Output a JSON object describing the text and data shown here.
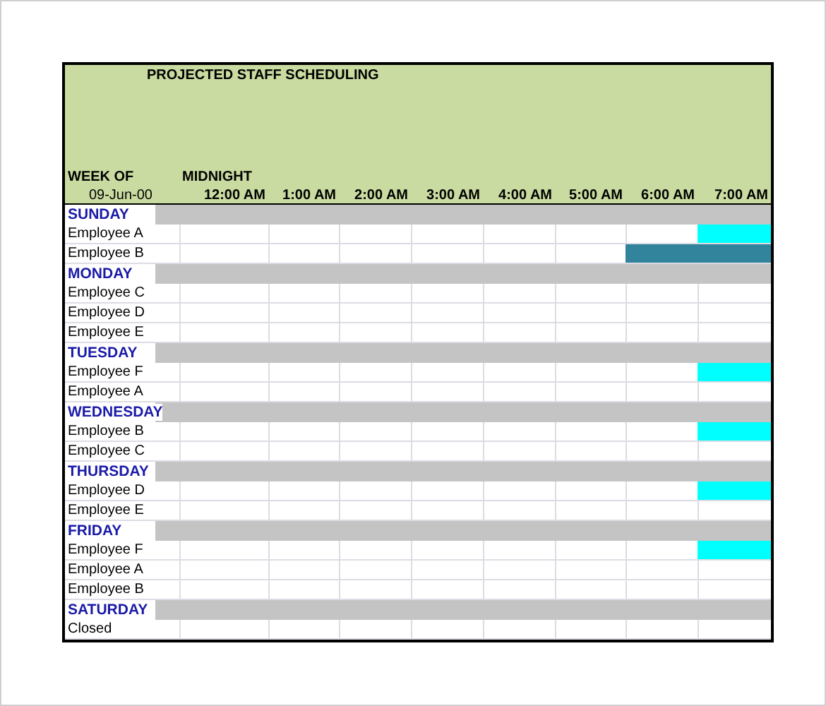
{
  "title": "PROJECTED STAFF SCHEDULING",
  "week_of_label": "WEEK OF",
  "week_of_date": "09-Jun-00",
  "midnight_label": "MIDNIGHT",
  "hours": [
    "12:00 AM",
    "1:00 AM",
    "2:00 AM",
    "3:00 AM",
    "4:00 AM",
    "5:00 AM",
    "6:00 AM",
    "7:00 AM"
  ],
  "rows": [
    {
      "kind": "day",
      "label": "SUNDAY"
    },
    {
      "kind": "employee",
      "label": "Employee A",
      "slots": [
        {
          "on": false
        },
        {
          "on": false
        },
        {
          "on": false
        },
        {
          "on": false
        },
        {
          "on": false
        },
        {
          "on": false
        },
        {
          "on": false
        },
        {
          "on": true,
          "color": "#00ffff"
        }
      ]
    },
    {
      "kind": "employee",
      "label": "Employee B",
      "slots": [
        {
          "on": false
        },
        {
          "on": false
        },
        {
          "on": false
        },
        {
          "on": false
        },
        {
          "on": false
        },
        {
          "on": false
        },
        {
          "on": true,
          "color": "#31849b"
        },
        {
          "on": true,
          "color": "#31849b"
        }
      ]
    },
    {
      "kind": "day",
      "label": "MONDAY"
    },
    {
      "kind": "employee",
      "label": "Employee C",
      "slots": [
        {
          "on": false
        },
        {
          "on": false
        },
        {
          "on": false
        },
        {
          "on": false
        },
        {
          "on": false
        },
        {
          "on": false
        },
        {
          "on": false
        },
        {
          "on": false
        }
      ]
    },
    {
      "kind": "employee",
      "label": "Employee D",
      "slots": [
        {
          "on": false
        },
        {
          "on": false
        },
        {
          "on": false
        },
        {
          "on": false
        },
        {
          "on": false
        },
        {
          "on": false
        },
        {
          "on": false
        },
        {
          "on": false
        }
      ]
    },
    {
      "kind": "employee",
      "label": "Employee E",
      "slots": [
        {
          "on": false
        },
        {
          "on": false
        },
        {
          "on": false
        },
        {
          "on": false
        },
        {
          "on": false
        },
        {
          "on": false
        },
        {
          "on": false
        },
        {
          "on": false
        }
      ]
    },
    {
      "kind": "day",
      "label": "TUESDAY"
    },
    {
      "kind": "employee",
      "label": "Employee F",
      "slots": [
        {
          "on": false
        },
        {
          "on": false
        },
        {
          "on": false
        },
        {
          "on": false
        },
        {
          "on": false
        },
        {
          "on": false
        },
        {
          "on": false
        },
        {
          "on": true,
          "color": "#00ffff"
        }
      ]
    },
    {
      "kind": "employee",
      "label": "Employee A",
      "slots": [
        {
          "on": false
        },
        {
          "on": false
        },
        {
          "on": false
        },
        {
          "on": false
        },
        {
          "on": false
        },
        {
          "on": false
        },
        {
          "on": false
        },
        {
          "on": false
        }
      ]
    },
    {
      "kind": "day",
      "label": "WEDNESDAY"
    },
    {
      "kind": "employee",
      "label": "Employee B",
      "slots": [
        {
          "on": false
        },
        {
          "on": false
        },
        {
          "on": false
        },
        {
          "on": false
        },
        {
          "on": false
        },
        {
          "on": false
        },
        {
          "on": false
        },
        {
          "on": true,
          "color": "#00ffff"
        }
      ]
    },
    {
      "kind": "employee",
      "label": "Employee C",
      "slots": [
        {
          "on": false
        },
        {
          "on": false
        },
        {
          "on": false
        },
        {
          "on": false
        },
        {
          "on": false
        },
        {
          "on": false
        },
        {
          "on": false
        },
        {
          "on": false
        }
      ]
    },
    {
      "kind": "day",
      "label": "THURSDAY"
    },
    {
      "kind": "employee",
      "label": "Employee D",
      "slots": [
        {
          "on": false
        },
        {
          "on": false
        },
        {
          "on": false
        },
        {
          "on": false
        },
        {
          "on": false
        },
        {
          "on": false
        },
        {
          "on": false
        },
        {
          "on": true,
          "color": "#00ffff"
        }
      ]
    },
    {
      "kind": "employee",
      "label": "Employee E",
      "slots": [
        {
          "on": false
        },
        {
          "on": false
        },
        {
          "on": false
        },
        {
          "on": false
        },
        {
          "on": false
        },
        {
          "on": false
        },
        {
          "on": false
        },
        {
          "on": false
        }
      ]
    },
    {
      "kind": "day",
      "label": "FRIDAY"
    },
    {
      "kind": "employee",
      "label": "Employee F",
      "slots": [
        {
          "on": false
        },
        {
          "on": false
        },
        {
          "on": false
        },
        {
          "on": false
        },
        {
          "on": false
        },
        {
          "on": false
        },
        {
          "on": false
        },
        {
          "on": true,
          "color": "#00ffff"
        }
      ]
    },
    {
      "kind": "employee",
      "label": "Employee A",
      "slots": [
        {
          "on": false
        },
        {
          "on": false
        },
        {
          "on": false
        },
        {
          "on": false
        },
        {
          "on": false
        },
        {
          "on": false
        },
        {
          "on": false
        },
        {
          "on": false
        }
      ]
    },
    {
      "kind": "employee",
      "label": "Employee B",
      "slots": [
        {
          "on": false
        },
        {
          "on": false
        },
        {
          "on": false
        },
        {
          "on": false
        },
        {
          "on": false
        },
        {
          "on": false
        },
        {
          "on": false
        },
        {
          "on": false
        }
      ]
    },
    {
      "kind": "day",
      "label": "SATURDAY"
    },
    {
      "kind": "employee",
      "label": "Closed",
      "slots": [
        {
          "on": false
        },
        {
          "on": false
        },
        {
          "on": false
        },
        {
          "on": false
        },
        {
          "on": false
        },
        {
          "on": false
        },
        {
          "on": false
        },
        {
          "on": false
        }
      ]
    }
  ]
}
